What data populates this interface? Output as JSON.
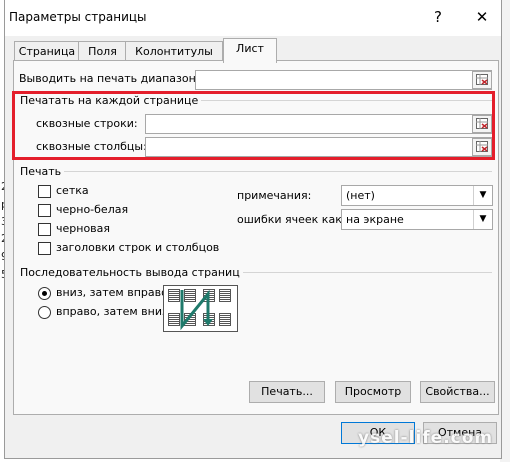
{
  "dialog": {
    "title": "Параметры страницы",
    "help_label": "?",
    "close_label": "✕"
  },
  "background_fragments": [
    "2",
    "р",
    "3",
    "2",
    "97",
    "5"
  ],
  "tabs": [
    {
      "label": "Страница",
      "active": false
    },
    {
      "label": "Поля",
      "active": false
    },
    {
      "label": "Колонтитулы",
      "active": false
    },
    {
      "label": "Лист",
      "active": true
    }
  ],
  "print_area": {
    "label": "Выводить на печать диапазон:",
    "value": ""
  },
  "print_titles": {
    "group_title": "Печатать на каждой странице",
    "rows_label": "сквозные строки:",
    "rows_value": "",
    "cols_label": "сквозные столбцы:",
    "cols_value": ""
  },
  "print": {
    "group_title": "Печать",
    "checkboxes": [
      {
        "label": "сетка",
        "checked": false
      },
      {
        "label": "черно-белая",
        "checked": false
      },
      {
        "label": "черновая",
        "checked": false
      },
      {
        "label": "заголовки строк и столбцов",
        "checked": false
      }
    ],
    "comments_label": "примечания:",
    "comments_value": "(нет)",
    "errors_label": "ошибки ячеек как:",
    "errors_value": "на экране"
  },
  "page_order": {
    "group_title": "Последовательность вывода страниц",
    "options": [
      {
        "label": "вниз, затем вправо",
        "selected": true
      },
      {
        "label": "вправо, затем вниз",
        "selected": false
      }
    ]
  },
  "buttons": {
    "print": "Печать...",
    "preview": "Просмотр",
    "properties": "Свойства...",
    "ok": "ОК",
    "cancel": "Отмена"
  },
  "watermark": "ysel-life.com",
  "colors": {
    "highlight": "#e41e2b",
    "accent": "#0078d7",
    "arrow": "#1f7a6b"
  }
}
